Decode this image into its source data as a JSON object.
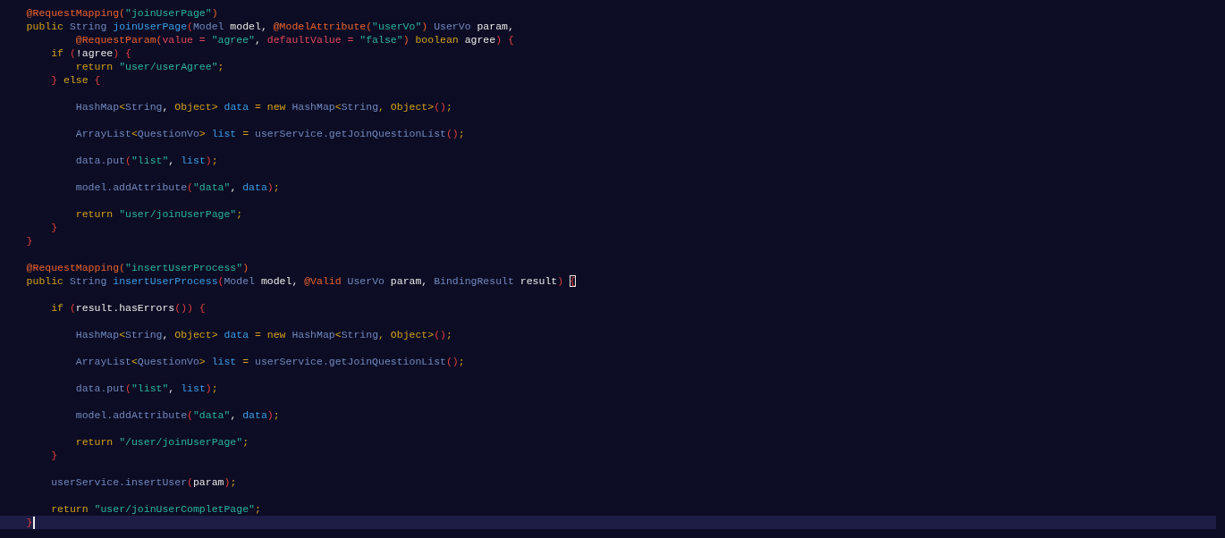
{
  "editor": {
    "lines": [
      {
        "current": false,
        "tokens": [
          {
            "text": "    @RequestMapping(",
            "kind": "annotation"
          },
          {
            "text": "\"joinUserPage\"",
            "kind": "string"
          },
          {
            "text": ")",
            "kind": "annotation"
          }
        ]
      },
      {
        "current": false,
        "tokens": [
          {
            "text": "    public",
            "kind": "keyword"
          },
          {
            "text": " String",
            "kind": "type"
          },
          {
            "text": " joinUserPage",
            "kind": "method"
          },
          {
            "text": "(",
            "kind": "brace"
          },
          {
            "text": "Model",
            "kind": "type"
          },
          {
            "text": " model, ",
            "kind": "plain"
          },
          {
            "text": "@ModelAttribute(",
            "kind": "annotation"
          },
          {
            "text": "\"userVo\"",
            "kind": "string"
          },
          {
            "text": ")",
            "kind": "annotation"
          },
          {
            "text": " UserVo",
            "kind": "type"
          },
          {
            "text": " param,",
            "kind": "plain"
          }
        ]
      },
      {
        "current": false,
        "tokens": [
          {
            "text": "            @RequestParam(",
            "kind": "annotation"
          },
          {
            "text": "value = ",
            "kind": "param"
          },
          {
            "text": "\"agree\"",
            "kind": "string"
          },
          {
            "text": ", ",
            "kind": "plain"
          },
          {
            "text": "defaultValue = ",
            "kind": "param"
          },
          {
            "text": "\"false\"",
            "kind": "string"
          },
          {
            "text": ")",
            "kind": "annotation"
          },
          {
            "text": " boolean",
            "kind": "keyword"
          },
          {
            "text": " agree",
            "kind": "plain"
          },
          {
            "text": ") {",
            "kind": "brace"
          }
        ]
      },
      {
        "current": false,
        "tokens": [
          {
            "text": "        if",
            "kind": "keyword"
          },
          {
            "text": " (",
            "kind": "brace"
          },
          {
            "text": "!agree",
            "kind": "plain"
          },
          {
            "text": ") {",
            "kind": "brace"
          }
        ]
      },
      {
        "current": false,
        "tokens": [
          {
            "text": "            return",
            "kind": "keyword"
          },
          {
            "text": " \"user/userAgree\"",
            "kind": "string"
          },
          {
            "text": ";",
            "kind": "keyword"
          }
        ]
      },
      {
        "current": false,
        "tokens": [
          {
            "text": "        } ",
            "kind": "brace"
          },
          {
            "text": "else",
            "kind": "keyword"
          },
          {
            "text": " {",
            "kind": "brace"
          }
        ]
      },
      {
        "current": false
      },
      {
        "current": false,
        "tokens": [
          {
            "text": "            HashMap",
            "kind": "type"
          },
          {
            "text": "<",
            "kind": "keyword"
          },
          {
            "text": "String",
            "kind": "type"
          },
          {
            "text": ", ",
            "kind": "plain"
          },
          {
            "text": "Object>",
            "kind": "keyword"
          },
          {
            "text": " data",
            "kind": "variable"
          },
          {
            "text": " = new",
            "kind": "keyword"
          },
          {
            "text": " HashMap",
            "kind": "type"
          },
          {
            "text": "<",
            "kind": "keyword"
          },
          {
            "text": "String",
            "kind": "type"
          },
          {
            "text": ", Object>",
            "kind": "keyword"
          },
          {
            "text": "()",
            "kind": "brace"
          },
          {
            "text": ";",
            "kind": "keyword"
          }
        ]
      },
      {
        "current": false
      },
      {
        "current": false,
        "tokens": [
          {
            "text": "            ArrayList",
            "kind": "type"
          },
          {
            "text": "<",
            "kind": "keyword"
          },
          {
            "text": "QuestionVo",
            "kind": "type"
          },
          {
            "text": ">",
            "kind": "keyword"
          },
          {
            "text": " list",
            "kind": "variable"
          },
          {
            "text": " =",
            "kind": "keyword"
          },
          {
            "text": " userService.getJoinQuestionList",
            "kind": "type"
          },
          {
            "text": "()",
            "kind": "brace"
          },
          {
            "text": ";",
            "kind": "keyword"
          }
        ]
      },
      {
        "current": false
      },
      {
        "current": false,
        "tokens": [
          {
            "text": "            data.put",
            "kind": "type"
          },
          {
            "text": "(",
            "kind": "brace"
          },
          {
            "text": "\"list\"",
            "kind": "string"
          },
          {
            "text": ", ",
            "kind": "plain"
          },
          {
            "text": "list",
            "kind": "variable"
          },
          {
            "text": ")",
            "kind": "brace"
          },
          {
            "text": ";",
            "kind": "keyword"
          }
        ]
      },
      {
        "current": false
      },
      {
        "current": false,
        "tokens": [
          {
            "text": "            model.addAttribute",
            "kind": "type"
          },
          {
            "text": "(",
            "kind": "brace"
          },
          {
            "text": "\"data\"",
            "kind": "string"
          },
          {
            "text": ", ",
            "kind": "plain"
          },
          {
            "text": "data",
            "kind": "variable"
          },
          {
            "text": ")",
            "kind": "brace"
          },
          {
            "text": ";",
            "kind": "keyword"
          }
        ]
      },
      {
        "current": false
      },
      {
        "current": false,
        "tokens": [
          {
            "text": "            return",
            "kind": "keyword"
          },
          {
            "text": " \"user/joinUserPage\"",
            "kind": "string"
          },
          {
            "text": ";",
            "kind": "keyword"
          }
        ]
      },
      {
        "current": false,
        "tokens": [
          {
            "text": "        }",
            "kind": "brace"
          }
        ]
      },
      {
        "current": false,
        "tokens": [
          {
            "text": "    }",
            "kind": "brace"
          }
        ]
      },
      {
        "current": false
      },
      {
        "current": false,
        "tokens": [
          {
            "text": "    @RequestMapping(",
            "kind": "annotation"
          },
          {
            "text": "\"insertUserProcess\"",
            "kind": "string"
          },
          {
            "text": ")",
            "kind": "annotation"
          }
        ]
      },
      {
        "current": false,
        "tokens": [
          {
            "text": "    public",
            "kind": "keyword"
          },
          {
            "text": " String",
            "kind": "type"
          },
          {
            "text": " insertUserProcess",
            "kind": "method"
          },
          {
            "text": "(",
            "kind": "brace"
          },
          {
            "text": "Model",
            "kind": "type"
          },
          {
            "text": " model, ",
            "kind": "plain"
          },
          {
            "text": "@Valid",
            "kind": "annotation"
          },
          {
            "text": " UserVo",
            "kind": "type"
          },
          {
            "text": " param, ",
            "kind": "plain"
          },
          {
            "text": "BindingResult",
            "kind": "type"
          },
          {
            "text": " result",
            "kind": "plain"
          },
          {
            "text": ") ",
            "kind": "brace"
          },
          {
            "text": "{",
            "kind": "brace",
            "matched": true
          }
        ]
      },
      {
        "current": false
      },
      {
        "current": false,
        "tokens": [
          {
            "text": "        if",
            "kind": "keyword"
          },
          {
            "text": " (",
            "kind": "brace"
          },
          {
            "text": "result.hasErrors",
            "kind": "plain"
          },
          {
            "text": "())",
            "kind": "brace"
          },
          {
            "text": " {",
            "kind": "brace"
          }
        ]
      },
      {
        "current": false
      },
      {
        "current": false,
        "tokens": [
          {
            "text": "            HashMap",
            "kind": "type"
          },
          {
            "text": "<",
            "kind": "keyword"
          },
          {
            "text": "String",
            "kind": "type"
          },
          {
            "text": ", ",
            "kind": "plain"
          },
          {
            "text": "Object>",
            "kind": "keyword"
          },
          {
            "text": " data",
            "kind": "variable"
          },
          {
            "text": " = new",
            "kind": "keyword"
          },
          {
            "text": " HashMap",
            "kind": "type"
          },
          {
            "text": "<",
            "kind": "keyword"
          },
          {
            "text": "String",
            "kind": "type"
          },
          {
            "text": ", Object>",
            "kind": "keyword"
          },
          {
            "text": "()",
            "kind": "brace"
          },
          {
            "text": ";",
            "kind": "keyword"
          }
        ]
      },
      {
        "current": false
      },
      {
        "current": false,
        "tokens": [
          {
            "text": "            ArrayList",
            "kind": "type"
          },
          {
            "text": "<",
            "kind": "keyword"
          },
          {
            "text": "QuestionVo",
            "kind": "type"
          },
          {
            "text": ">",
            "kind": "keyword"
          },
          {
            "text": " list",
            "kind": "variable"
          },
          {
            "text": " =",
            "kind": "keyword"
          },
          {
            "text": " userService.getJoinQuestionList",
            "kind": "type"
          },
          {
            "text": "()",
            "kind": "brace"
          },
          {
            "text": ";",
            "kind": "keyword"
          }
        ]
      },
      {
        "current": false
      },
      {
        "current": false,
        "tokens": [
          {
            "text": "            data.put",
            "kind": "type"
          },
          {
            "text": "(",
            "kind": "brace"
          },
          {
            "text": "\"list\"",
            "kind": "string"
          },
          {
            "text": ", ",
            "kind": "plain"
          },
          {
            "text": "list",
            "kind": "variable"
          },
          {
            "text": ")",
            "kind": "brace"
          },
          {
            "text": ";",
            "kind": "keyword"
          }
        ]
      },
      {
        "current": false
      },
      {
        "current": false,
        "tokens": [
          {
            "text": "            model.addAttribute",
            "kind": "type"
          },
          {
            "text": "(",
            "kind": "brace"
          },
          {
            "text": "\"data\"",
            "kind": "string"
          },
          {
            "text": ", ",
            "kind": "plain"
          },
          {
            "text": "data",
            "kind": "variable"
          },
          {
            "text": ")",
            "kind": "brace"
          },
          {
            "text": ";",
            "kind": "keyword"
          }
        ]
      },
      {
        "current": false
      },
      {
        "current": false,
        "tokens": [
          {
            "text": "            return",
            "kind": "keyword"
          },
          {
            "text": " \"/user/joinUserPage\"",
            "kind": "string"
          },
          {
            "text": ";",
            "kind": "keyword"
          }
        ]
      },
      {
        "current": false,
        "tokens": [
          {
            "text": "        }",
            "kind": "brace"
          }
        ]
      },
      {
        "current": false
      },
      {
        "current": false,
        "tokens": [
          {
            "text": "        userService.insertUser",
            "kind": "type"
          },
          {
            "text": "(",
            "kind": "brace"
          },
          {
            "text": "param",
            "kind": "plain"
          },
          {
            "text": ")",
            "kind": "brace"
          },
          {
            "text": ";",
            "kind": "keyword"
          }
        ]
      },
      {
        "current": false
      },
      {
        "current": false,
        "tokens": [
          {
            "text": "        return",
            "kind": "keyword"
          },
          {
            "text": " \"user/joinUserCompletPage\"",
            "kind": "string"
          },
          {
            "text": ";",
            "kind": "keyword"
          }
        ]
      },
      {
        "current": true,
        "tokens": [
          {
            "text": "    }",
            "kind": "brace"
          }
        ]
      }
    ]
  }
}
